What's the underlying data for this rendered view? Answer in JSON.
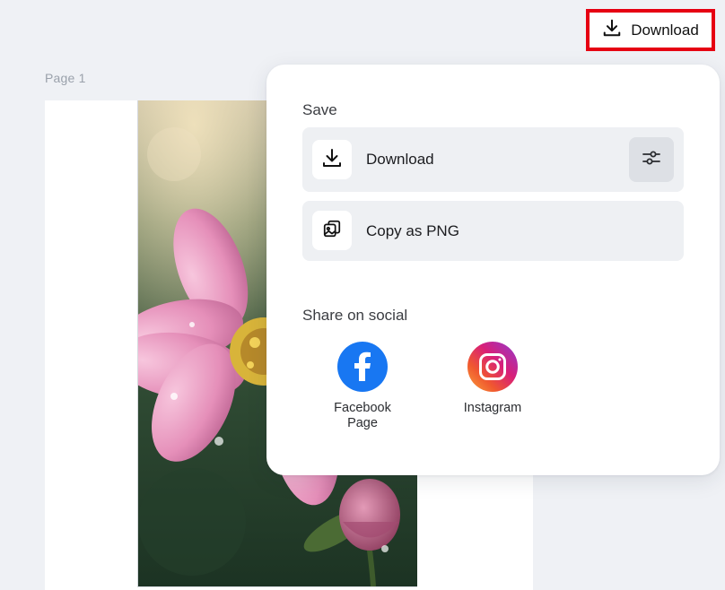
{
  "page": {
    "label": "Page 1"
  },
  "header": {
    "download_label": "Download",
    "download_icon": "download-icon"
  },
  "panel": {
    "save_title": "Save",
    "download": {
      "label": "Download",
      "icon": "download-icon",
      "settings_icon": "sliders-icon"
    },
    "copy_png": {
      "label": "Copy as PNG",
      "icon": "copy-image-icon"
    },
    "share_title": "Share on social",
    "social": [
      {
        "label": "Facebook\nPage",
        "icon": "facebook-icon",
        "color": "#1877f2"
      },
      {
        "label": "Instagram",
        "icon": "instagram-icon",
        "color": "#e1306c"
      }
    ]
  },
  "colors": {
    "highlight": "#e60012",
    "background": "#eff1f5"
  }
}
